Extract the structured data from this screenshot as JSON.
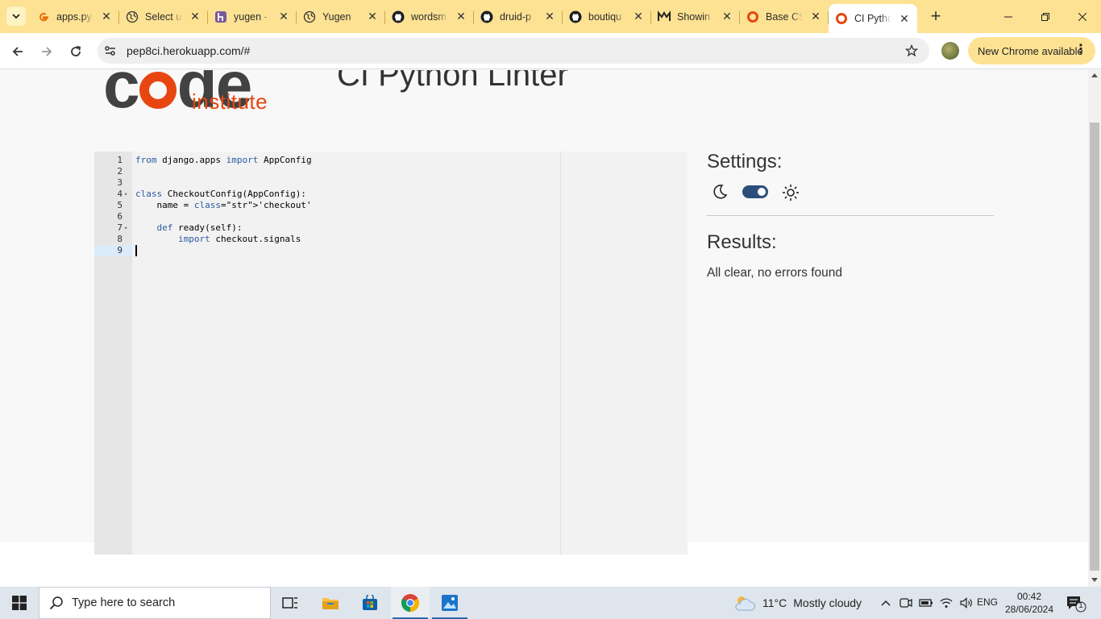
{
  "browser": {
    "tabs": [
      {
        "title": "apps.py",
        "icon": "google-g-icon",
        "active": false
      },
      {
        "title": "Select u",
        "icon": "globe-icon",
        "active": false
      },
      {
        "title": "yugen -",
        "icon": "heroku-icon",
        "active": false
      },
      {
        "title": "Yugen",
        "icon": "globe-icon",
        "active": false
      },
      {
        "title": "wordsm",
        "icon": "github-icon",
        "active": false
      },
      {
        "title": "druid-p",
        "icon": "github-icon",
        "active": false
      },
      {
        "title": "boutiqu",
        "icon": "github-icon",
        "active": false
      },
      {
        "title": "Showin",
        "icon": "codeinstitute-m-icon",
        "active": false
      },
      {
        "title": "Base CS",
        "icon": "codeinstitute-o-icon",
        "active": false
      },
      {
        "title": "CI Pytho",
        "icon": "codeinstitute-o-icon",
        "active": true
      }
    ],
    "url": "pep8ci.herokuapp.com/#",
    "new_chrome_label": "New Chrome available",
    "accent": "#fde293"
  },
  "page": {
    "logo": {
      "word": "code",
      "subword": "institute",
      "brand_color": "#e84610"
    },
    "title": "CI Python Linter",
    "editor": {
      "lines": [
        {
          "n": "1",
          "code": "from django.apps import AppConfig",
          "fold": ""
        },
        {
          "n": "2",
          "code": "",
          "fold": ""
        },
        {
          "n": "3",
          "code": "",
          "fold": ""
        },
        {
          "n": "4",
          "code": "class CheckoutConfig(AppConfig):",
          "fold": "▾"
        },
        {
          "n": "5",
          "code": "    name = 'checkout'",
          "fold": ""
        },
        {
          "n": "6",
          "code": "",
          "fold": ""
        },
        {
          "n": "7",
          "code": "    def ready(self):",
          "fold": "▾"
        },
        {
          "n": "8",
          "code": "        import checkout.signals",
          "fold": ""
        },
        {
          "n": "9",
          "code": "",
          "fold": ""
        }
      ],
      "active_line": "9"
    },
    "settings": {
      "title": "Settings:",
      "dark_mode_on": true
    },
    "results": {
      "title": "Results:",
      "message": "All clear, no errors found"
    }
  },
  "taskbar": {
    "search_placeholder": "Type here to search",
    "weather": {
      "temp": "11°C",
      "condition": "Mostly cloudy"
    },
    "language": "ENG",
    "time": "00:42",
    "date": "28/06/2024",
    "notifications": "1"
  }
}
